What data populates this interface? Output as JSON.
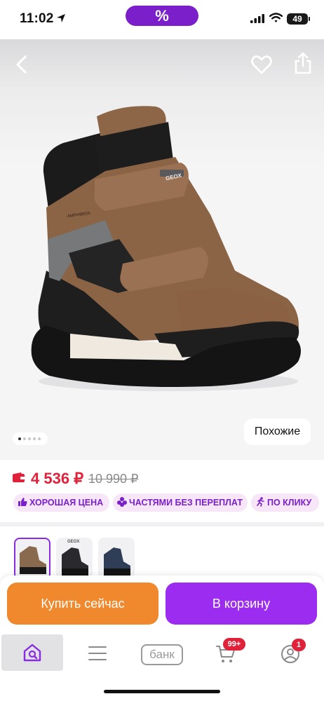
{
  "status_bar": {
    "time": "11:02",
    "promo_label": "%",
    "battery": "49"
  },
  "gallery": {
    "similar_label": "Похожие",
    "dots_count": 5,
    "active_dot": 1,
    "brand_mark": "GEOX",
    "model_mark": "AMPHIBIOX"
  },
  "price": {
    "current": "4 536 ₽",
    "old": "10 990 ₽"
  },
  "badges": [
    "ХОРОШАЯ ЦЕНА",
    "ЧАСТЯМИ БЕЗ ПЕРЕПЛАТ",
    "ПО КЛИКУ"
  ],
  "thumbnails": {
    "selected_index": 0,
    "count": 3,
    "colors": [
      "#8a6a4e",
      "#2a2a2e",
      "#2f3d57"
    ],
    "brand_mark": "GEOX"
  },
  "actions": {
    "buy_now": "Купить сейчас",
    "add_to_cart": "В корзину"
  },
  "tabbar": {
    "bank_label": "банк",
    "cart_count": "99+",
    "profile_count": "1",
    "active": "home"
  },
  "colors": {
    "accent": "#9b2cf0",
    "buy_now": "#f0892d",
    "price": "#e0213a",
    "badge_bg": "#f7e6f8"
  }
}
